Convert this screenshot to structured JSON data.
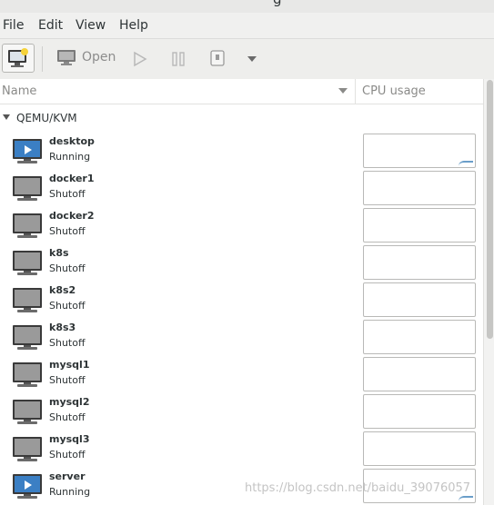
{
  "window": {
    "title_fragment": "g"
  },
  "menubar": [
    "File",
    "Edit",
    "View",
    "Help"
  ],
  "toolbar": {
    "open_label": "Open"
  },
  "columns": {
    "name": "Name",
    "cpu": "CPU usage"
  },
  "group": {
    "label": "QEMU/KVM"
  },
  "vms": [
    {
      "name": "desktop",
      "state": "Running"
    },
    {
      "name": "docker1",
      "state": "Shutoff"
    },
    {
      "name": "docker2",
      "state": "Shutoff"
    },
    {
      "name": "k8s",
      "state": "Shutoff"
    },
    {
      "name": "k8s2",
      "state": "Shutoff"
    },
    {
      "name": "k8s3",
      "state": "Shutoff"
    },
    {
      "name": "mysql1",
      "state": "Shutoff"
    },
    {
      "name": "mysql2",
      "state": "Shutoff"
    },
    {
      "name": "mysql3",
      "state": "Shutoff"
    },
    {
      "name": "server",
      "state": "Running"
    }
  ],
  "watermark": "https://blog.csdn.net/baidu_39076057",
  "colors": {
    "running_screen": "#3b7fc4",
    "shutoff_screen": "#9a9a9a",
    "cpu_graph": "#6a9ec9"
  }
}
